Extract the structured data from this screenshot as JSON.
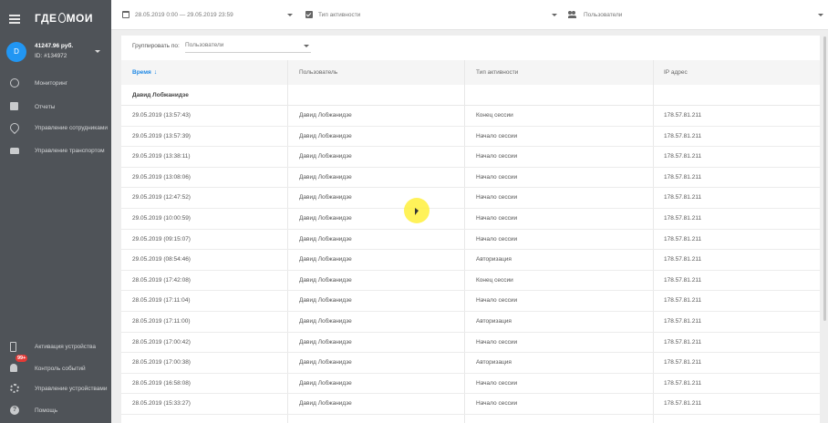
{
  "app": {
    "logo_left": "ГДЕ",
    "logo_right": "МОИ"
  },
  "account": {
    "avatar_letter": "D",
    "balance": "41247.96 руб.",
    "id": "ID: #134972"
  },
  "sidebar": {
    "items": [
      {
        "label": "Мониторинг",
        "icon": "globe-icon"
      },
      {
        "label": "Отчеты",
        "icon": "report-icon"
      },
      {
        "label": "Управление сотрудниками",
        "icon": "location-person-icon"
      },
      {
        "label": "Управление транспортом",
        "icon": "car-icon"
      }
    ],
    "bottom_items": [
      {
        "label": "Активация устройства",
        "icon": "device-activate-icon"
      },
      {
        "label": "Контроль событий",
        "icon": "bell-icon",
        "badge": "99+"
      },
      {
        "label": "Управление устройствами",
        "icon": "gear-icon"
      },
      {
        "label": "Помощь",
        "icon": "help-icon"
      }
    ]
  },
  "filters": {
    "date_range": "28.05.2019 0:00 — 29.05.2019 23:59",
    "activity_type": "Тип активности",
    "users": "Пользователи"
  },
  "grouping": {
    "label": "Группировать по:",
    "value": "Пользователи"
  },
  "table": {
    "columns": [
      "Время",
      "Пользователь",
      "Тип активности",
      "IP адрес"
    ],
    "group_name": "Давид Лобжанидзе",
    "rows": [
      [
        "29.05.2019 (13:57:43)",
        "Давид Лобжанидзе",
        "Конец сессии",
        "178.57.81.211"
      ],
      [
        "29.05.2019 (13:57:39)",
        "Давид Лобжанидзе",
        "Начало сессии",
        "178.57.81.211"
      ],
      [
        "29.05.2019 (13:38:11)",
        "Давид Лобжанидзе",
        "Начало сессии",
        "178.57.81.211"
      ],
      [
        "29.05.2019 (13:08:06)",
        "Давид Лобжанидзе",
        "Начало сессии",
        "178.57.81.211"
      ],
      [
        "29.05.2019 (12:47:52)",
        "Давид Лобжанидзе",
        "Начало сессии",
        "178.57.81.211"
      ],
      [
        "29.05.2019 (10:00:59)",
        "Давид Лобжанидзе",
        "Начало сессии",
        "178.57.81.211"
      ],
      [
        "29.05.2019 (09:15:07)",
        "Давид Лобжанидзе",
        "Начало сессии",
        "178.57.81.211"
      ],
      [
        "29.05.2019 (08:54:46)",
        "Давид Лобжанидзе",
        "Авторизация",
        "178.57.81.211"
      ],
      [
        "28.05.2019 (17:42:08)",
        "Давид Лобжанидзе",
        "Конец сессии",
        "178.57.81.211"
      ],
      [
        "28.05.2019 (17:11:04)",
        "Давид Лобжанидзе",
        "Начало сессии",
        "178.57.81.211"
      ],
      [
        "28.05.2019 (17:11:00)",
        "Давид Лобжанидзе",
        "Авторизация",
        "178.57.81.211"
      ],
      [
        "28.05.2019 (17:00:42)",
        "Давид Лобжанидзе",
        "Начало сессии",
        "178.57.81.211"
      ],
      [
        "28.05.2019 (17:00:38)",
        "Давид Лобжанидзе",
        "Авторизация",
        "178.57.81.211"
      ],
      [
        "28.05.2019 (16:58:08)",
        "Давид Лобжанидзе",
        "Начало сессии",
        "178.57.81.211"
      ],
      [
        "28.05.2019 (15:33:27)",
        "Давид Лобжанидзе",
        "Начало сессии",
        "178.57.81.211"
      ]
    ]
  },
  "colors": {
    "sidebar_bg": "#4f5358",
    "accent": "#1e88e5",
    "avatar": "#2196f3",
    "badge": "#e53935"
  }
}
